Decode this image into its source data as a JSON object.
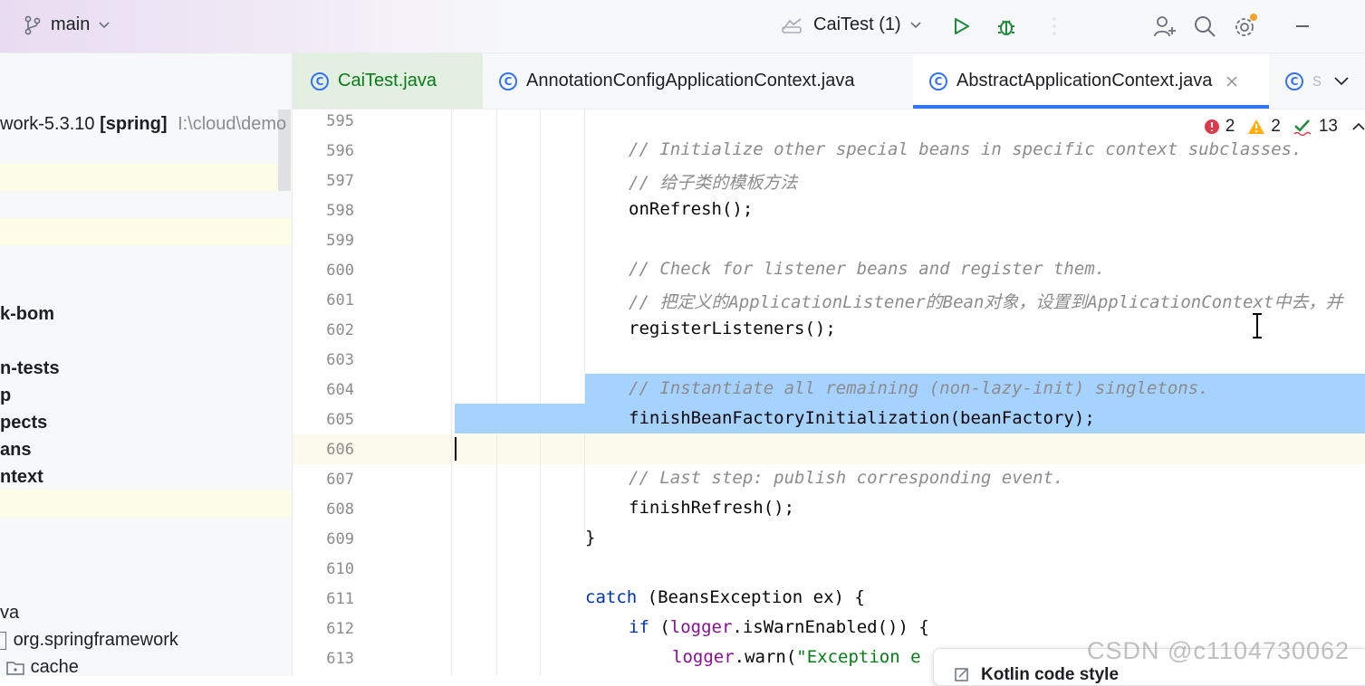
{
  "titlebar": {
    "branch": "main",
    "run_config": "CaiTest (1)"
  },
  "sidebar": {
    "items": [
      {
        "label": "work-5.3.10",
        "bold": false
      },
      {
        "label": "[spring]",
        "bold": true
      },
      {
        "label": "I:\\cloud\\demo",
        "bold": false
      },
      {
        "label": "k-bom"
      },
      {
        "label": "n-tests"
      },
      {
        "label": "p"
      },
      {
        "label": "pects"
      },
      {
        "label": "ans"
      },
      {
        "label": "ntext"
      },
      {
        "label": "va"
      },
      {
        "label": "org.springframework"
      },
      {
        "label": "cache"
      }
    ]
  },
  "tabs": [
    {
      "label": "CaiTest.java",
      "active": false,
      "color": "#067d17"
    },
    {
      "label": "AnnotationConfigApplicationContext.java",
      "active": false
    },
    {
      "label": "AbstractApplicationContext.java",
      "active": true
    },
    {
      "label": "s",
      "active": false
    }
  ],
  "inspections": {
    "errors": "2",
    "warnings": "2",
    "typos": "13"
  },
  "editor": {
    "line_numbers": [
      "595",
      "596",
      "597",
      "598",
      "599",
      "600",
      "601",
      "602",
      "603",
      "604",
      "605",
      "606",
      "607",
      "608",
      "609",
      "610",
      "611",
      "612",
      "613"
    ],
    "lines": {
      "l596": "// Initialize other special beans in specific context subclasses.",
      "l597": "// 给子类的模板方法",
      "l598": "onRefresh();",
      "l600": "// Check for listener beans and register them.",
      "l601": "// 把定义的ApplicationListener的Bean对象，设置到ApplicationContext中去，并",
      "l602": "registerListeners();",
      "l604": "// Instantiate all remaining (non-lazy-init) singletons.",
      "l605": "finishBeanFactoryInitialization(beanFactory);",
      "l607": "// Last step: publish corresponding event.",
      "l608": "finishRefresh();",
      "l609": "}",
      "l611_kw": "catch",
      "l611_rest": " (BeansException ex) {",
      "l612_kw": "if",
      "l612_a": " (",
      "l612_fld": "logger",
      "l612_b": ".isWarnEnabled()) {",
      "l613_fld": "logger",
      "l613_a": ".warn(",
      "l613_str": "\"Exception e"
    }
  },
  "popup": {
    "label": "Kotlin code style"
  },
  "watermark": "CSDN @c1104730062"
}
